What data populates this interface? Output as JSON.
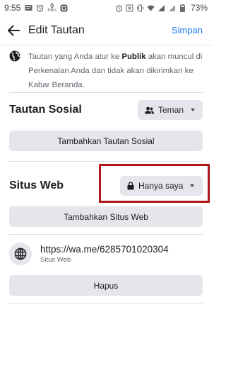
{
  "status_bar": {
    "time": "9:55",
    "net_speed_value": "0",
    "net_speed_unit": "KB/s",
    "battery": "73%"
  },
  "header": {
    "title": "Edit Tautan",
    "save_label": "Simpan"
  },
  "notice": {
    "text_before": "Tautan yang Anda atur ke ",
    "text_bold": "Publik",
    "text_after": " akan muncul di Perkenalan Anda dan tidak akan dikirimkan ke Kabar Beranda."
  },
  "social": {
    "title": "Tautan Sosial",
    "privacy_label": "Teman",
    "add_label": "Tambahkan Tautan Sosial"
  },
  "website": {
    "title": "Situs Web",
    "privacy_label": "Hanya saya",
    "add_label": "Tambahkan Situs Web",
    "highlight_color": "#b0151a"
  },
  "link": {
    "url": "https://wa.me/6285701020304",
    "type": "Situs Web",
    "delete_label": "Hapus"
  },
  "colors": {
    "accent": "#1877f2",
    "button_bg": "#e4e6eb"
  }
}
